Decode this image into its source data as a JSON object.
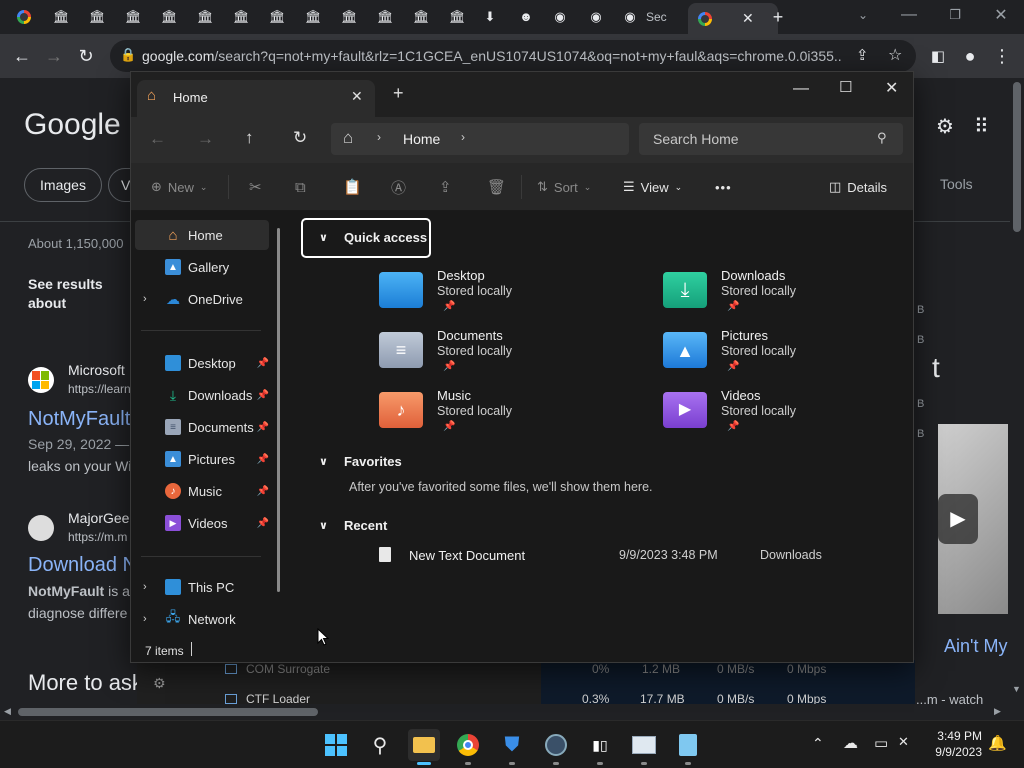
{
  "chrome": {
    "active_tab_label": "Sec",
    "url_host": "google.com",
    "url_rest": "/search?q=not+my+fault&rlz=1C1GCEA_enUS1074US1074&oq=not+my+faul&aqs=chrome.0.0i355..."
  },
  "google": {
    "logo": "Google",
    "chip_images": "Images",
    "chip_v": "V",
    "tools": "Tools",
    "about": "About 1,150,000",
    "see_results_1": "See results",
    "see_results_2": "about",
    "r1_site": "Microsoft",
    "r1_url": "https://learn",
    "r1_title": "NotMyFault",
    "r1_date": "Sep 29, 2022 — N",
    "r1_snip": "leaks on your Wi",
    "r2_site": "MajorGee",
    "r2_url": "https://m.m",
    "r2_title": "Download N",
    "r2_snip1_bold": "NotMyFault",
    "r2_snip1": " is a",
    "r2_snip2": "diagnose differe",
    "more": "More to ask",
    "right_letter": "t",
    "right_b": "B",
    "aint": "Ain't My",
    "watch": "...m - watch"
  },
  "taskmgr": {
    "rows": [
      {
        "name": "COM Surrogate",
        "cpu": "0%",
        "mem": "1.2 MB",
        "disk": "0 MB/s",
        "net": "0 Mbps"
      },
      {
        "name": "CTF Loader",
        "cpu": "0.3%",
        "mem": "17.7 MB",
        "disk": "0 MB/s",
        "net": "0 Mbps"
      }
    ]
  },
  "explorer": {
    "tab_title": "Home",
    "breadcrumb": "Home",
    "search_placeholder": "Search Home",
    "cmd": {
      "new": "New",
      "sort": "Sort",
      "view": "View",
      "more": "•••",
      "details": "Details"
    },
    "nav": {
      "home": "Home",
      "gallery": "Gallery",
      "onedrive": "OneDrive",
      "desktop": "Desktop",
      "downloads": "Downloads",
      "documents": "Documents",
      "pictures": "Pictures",
      "music": "Music",
      "videos": "Videos",
      "thispc": "This PC",
      "network": "Network"
    },
    "quick_access": "Quick access",
    "favorites": "Favorites",
    "favorites_empty": "After you've favorited some files, we'll show them here.",
    "recent": "Recent",
    "qa_items": [
      {
        "name": "Desktop",
        "sub": "Stored locally"
      },
      {
        "name": "Downloads",
        "sub": "Stored locally"
      },
      {
        "name": "Documents",
        "sub": "Stored locally"
      },
      {
        "name": "Pictures",
        "sub": "Stored locally"
      },
      {
        "name": "Music",
        "sub": "Stored locally"
      },
      {
        "name": "Videos",
        "sub": "Stored locally"
      }
    ],
    "recent_file": {
      "name": "New Text Document",
      "date": "9/9/2023 3:48 PM",
      "location": "Downloads"
    },
    "status": "7 items"
  },
  "taskbar": {
    "time": "3:49 PM",
    "date": "9/9/2023"
  },
  "colors": {
    "accent": "#4cc2ff",
    "link": "#8ab4f8"
  }
}
